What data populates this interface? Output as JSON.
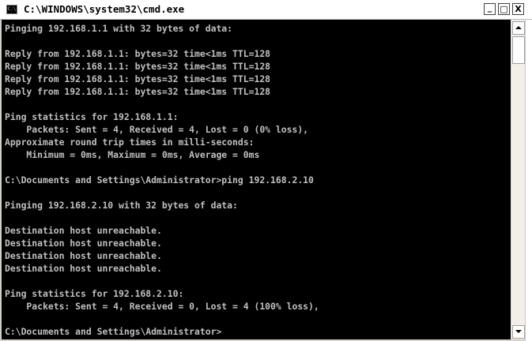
{
  "window": {
    "title": "C:\\WINDOWS\\system32\\cmd.exe",
    "icon": "C:\\",
    "controls": {
      "minimize": "_",
      "maximize": "□",
      "close": "X"
    }
  },
  "console": {
    "lines": [
      "Pinging 192.168.1.1 with 32 bytes of data:",
      "",
      "Reply from 192.168.1.1: bytes=32 time<1ms TTL=128",
      "Reply from 192.168.1.1: bytes=32 time<1ms TTL=128",
      "Reply from 192.168.1.1: bytes=32 time<1ms TTL=128",
      "Reply from 192.168.1.1: bytes=32 time<1ms TTL=128",
      "",
      "Ping statistics for 192.168.1.1:",
      "    Packets: Sent = 4, Received = 4, Lost = 0 (0% loss),",
      "Approximate round trip times in milli-seconds:",
      "    Minimum = 0ms, Maximum = 0ms, Average = 0ms",
      "",
      "C:\\Documents and Settings\\Administrator>ping 192.168.2.10",
      "",
      "Pinging 192.168.2.10 with 32 bytes of data:",
      "",
      "Destination host unreachable.",
      "Destination host unreachable.",
      "Destination host unreachable.",
      "Destination host unreachable.",
      "",
      "Ping statistics for 192.168.2.10:",
      "    Packets: Sent = 4, Received = 0, Lost = 4 (100% loss),",
      "",
      "C:\\Documents and Settings\\Administrator>"
    ]
  },
  "colors": {
    "console_background": "#000000",
    "console_text": "#c0c0c0",
    "title_bar": "#ffffff"
  },
  "icons": {
    "app": "cmd-icon",
    "minimize": "minimize-icon",
    "maximize": "maximize-icon",
    "close": "close-icon",
    "scroll_up": "arrow-up-icon",
    "scroll_down": "arrow-down-icon"
  }
}
